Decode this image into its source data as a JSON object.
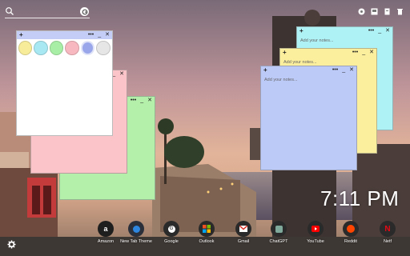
{
  "search": {
    "placeholder": ""
  },
  "notes": [
    {
      "name": "purple-note",
      "placeholder": ""
    },
    {
      "name": "pink-note",
      "placeholder": ""
    },
    {
      "name": "green-note",
      "placeholder": ""
    },
    {
      "name": "blue-note",
      "placeholder": "Add your notes..."
    },
    {
      "name": "yellow-note",
      "placeholder": "Add your notes..."
    },
    {
      "name": "cyan-note",
      "placeholder": "Add your notes..."
    }
  ],
  "note_controls": {
    "plus": "+",
    "menu": "•••",
    "minimize": "_",
    "close": "✕"
  },
  "swatch_colors": [
    "#f7ec9a",
    "#a8e8f2",
    "#a9eea6",
    "#f7b8c0",
    "#9aa6ea",
    "#e6e6e6"
  ],
  "clock": {
    "time": "7:11 PM"
  },
  "dock": [
    {
      "label": "Amazon",
      "glyph": "a",
      "color": "#111111"
    },
    {
      "label": "New Tab Theme",
      "glyph": "◐",
      "color": "#1b6fd6"
    },
    {
      "label": "Google",
      "glyph": "G",
      "color": "#333333"
    },
    {
      "label": "Outlook",
      "glyph": "▦",
      "color": "#2b2b2b"
    },
    {
      "label": "Gmail",
      "glyph": "M",
      "color": "#d33a2c"
    },
    {
      "label": "ChatGPT",
      "glyph": "✱",
      "color": "#3a3a3a"
    },
    {
      "label": "YouTube",
      "glyph": "▶",
      "color": "#d11"
    },
    {
      "label": "Reddit",
      "glyph": "●",
      "color": "#ff5700"
    },
    {
      "label": "Netf",
      "glyph": "N",
      "color": "#b00"
    }
  ]
}
